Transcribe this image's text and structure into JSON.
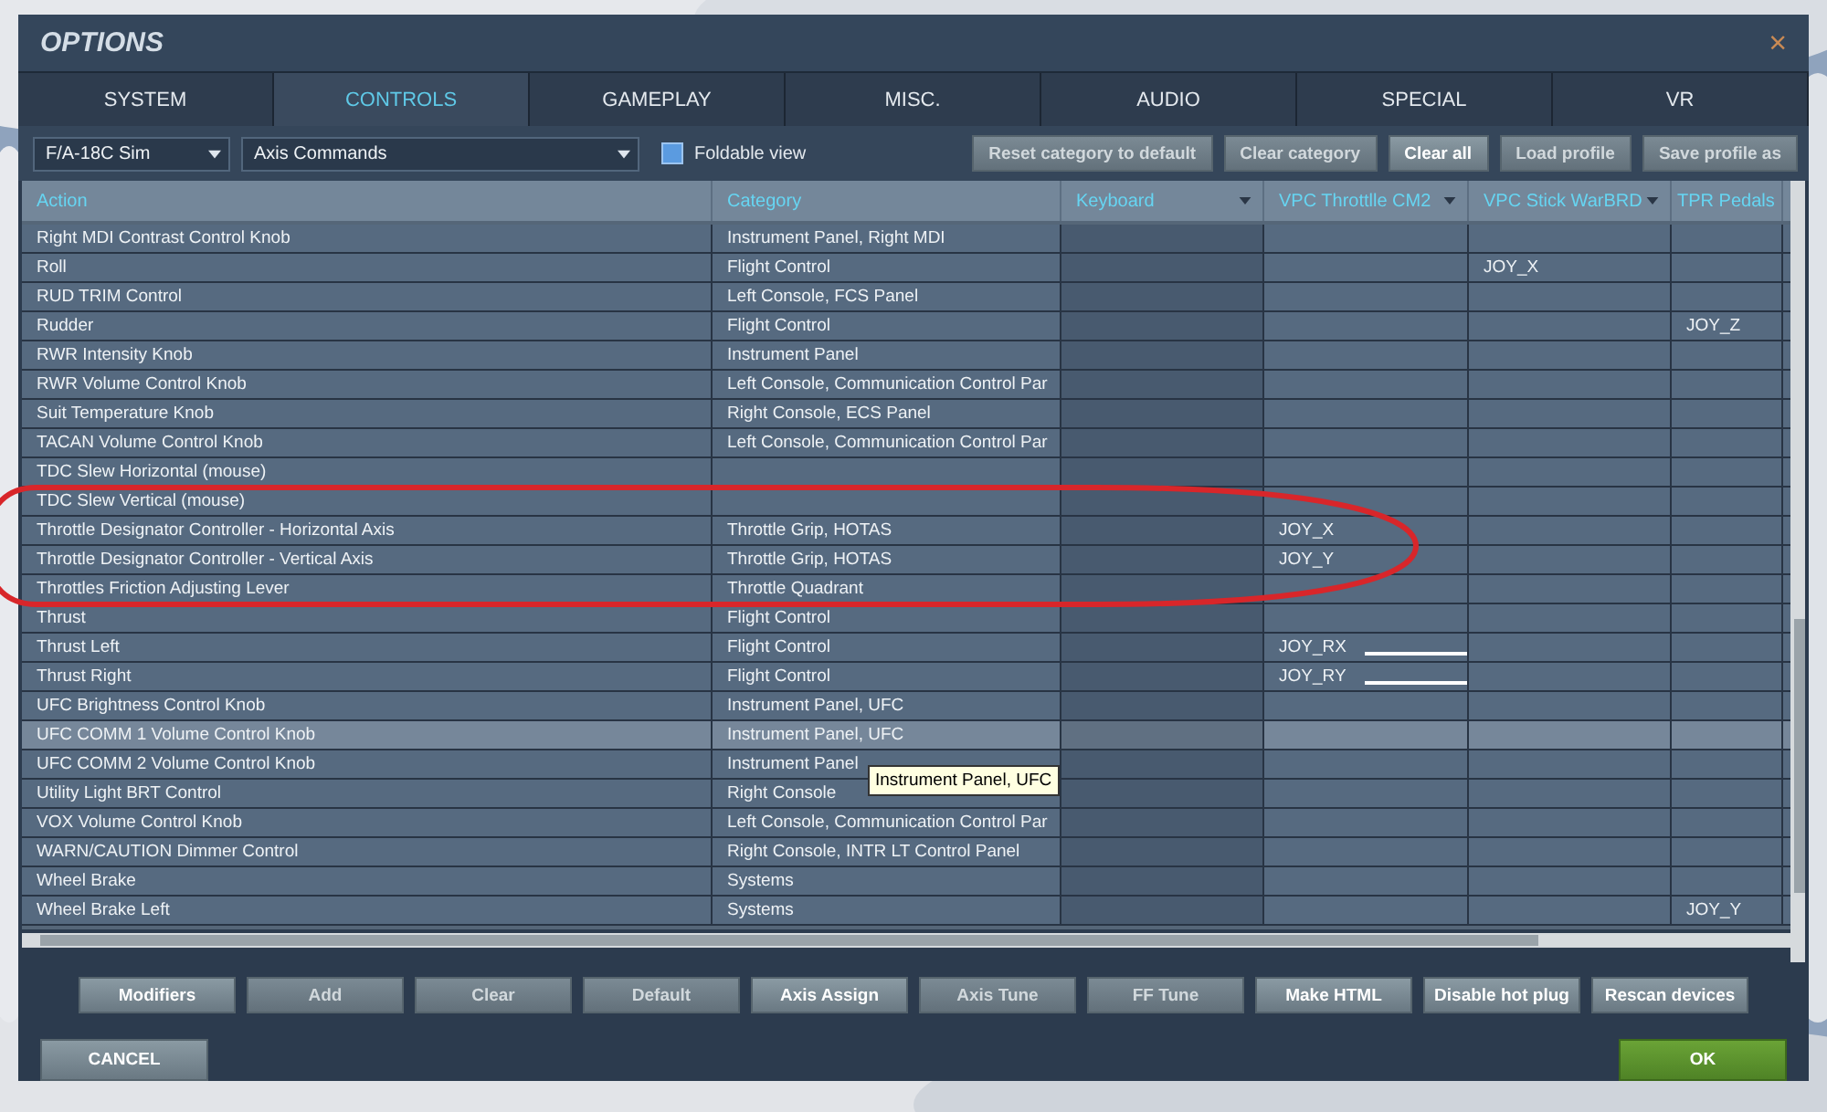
{
  "window": {
    "title": "OPTIONS",
    "close": "×"
  },
  "tabs": [
    {
      "label": "SYSTEM",
      "selected": false
    },
    {
      "label": "CONTROLS",
      "selected": true
    },
    {
      "label": "GAMEPLAY",
      "selected": false
    },
    {
      "label": "MISC.",
      "selected": false
    },
    {
      "label": "AUDIO",
      "selected": false
    },
    {
      "label": "SPECIAL",
      "selected": false
    },
    {
      "label": "VR",
      "selected": false
    }
  ],
  "toolbar": {
    "aircraft": "F/A-18C Sim",
    "category": "Axis Commands",
    "foldable_view": {
      "label": "Foldable view",
      "checked": true
    },
    "buttons": [
      {
        "label": "Reset category to default",
        "disabled": true
      },
      {
        "label": "Clear category",
        "disabled": true
      },
      {
        "label": "Clear all",
        "disabled": false
      },
      {
        "label": "Load profile",
        "disabled": true
      },
      {
        "label": "Save profile as",
        "disabled": true
      }
    ]
  },
  "table": {
    "columns": [
      {
        "label": "Action",
        "has_menu": false
      },
      {
        "label": "Category",
        "has_menu": false
      },
      {
        "label": "Keyboard",
        "has_menu": true
      },
      {
        "label": "VPC Throttlle CM2",
        "has_menu": true
      },
      {
        "label": "VPC Stick WarBRD",
        "has_menu": true
      },
      {
        "label": "TPR Pedals",
        "has_menu": false
      }
    ],
    "rows": [
      {
        "action": "Right MDI Contrast Control Knob",
        "category": "Instrument Panel, Right MDI",
        "selected": false,
        "throttle_line": false
      },
      {
        "action": "Roll",
        "category": "Flight Control",
        "stick": "JOY_X",
        "selected": false,
        "throttle_line": false
      },
      {
        "action": "RUD TRIM Control",
        "category": "Left Console, FCS Panel",
        "selected": false,
        "throttle_line": false
      },
      {
        "action": "Rudder",
        "category": "Flight Control",
        "pedals": "JOY_Z",
        "selected": false,
        "throttle_line": false
      },
      {
        "action": "RWR Intensity Knob",
        "category": "Instrument Panel",
        "selected": false,
        "throttle_line": false
      },
      {
        "action": "RWR Volume Control Knob",
        "category": "Left Console, Communication Control Par",
        "selected": false,
        "throttle_line": false
      },
      {
        "action": "Suit Temperature Knob",
        "category": "Right Console, ECS Panel",
        "selected": false,
        "throttle_line": false
      },
      {
        "action": "TACAN Volume Control Knob",
        "category": "Left Console, Communication Control Par",
        "selected": false,
        "throttle_line": false
      },
      {
        "action": "TDC Slew Horizontal (mouse)",
        "selected": false,
        "throttle_line": false
      },
      {
        "action": "TDC Slew Vertical (mouse)",
        "selected": false,
        "throttle_line": false
      },
      {
        "action": "Throttle Designator Controller - Horizontal Axis",
        "category": "Throttle Grip, HOTAS",
        "throttle": "JOY_X",
        "selected": false,
        "throttle_line": false
      },
      {
        "action": "Throttle Designator Controller - Vertical Axis",
        "category": "Throttle Grip, HOTAS",
        "throttle": "JOY_Y",
        "selected": false,
        "throttle_line": false
      },
      {
        "action": "Throttles Friction Adjusting Lever",
        "category": "Throttle Quadrant",
        "selected": false,
        "throttle_line": false
      },
      {
        "action": "Thrust",
        "category": "Flight Control",
        "selected": false,
        "throttle_line": false
      },
      {
        "action": "Thrust Left",
        "category": "Flight Control",
        "throttle": "JOY_RX",
        "selected": false,
        "throttle_line": true
      },
      {
        "action": "Thrust Right",
        "category": "Flight Control",
        "throttle": "JOY_RY",
        "selected": false,
        "throttle_line": true
      },
      {
        "action": "UFC Brightness Control Knob",
        "category": "Instrument Panel, UFC",
        "selected": false,
        "throttle_line": false
      },
      {
        "action": "UFC COMM 1 Volume Control Knob",
        "category": "Instrument Panel, UFC",
        "selected": true,
        "throttle_line": false
      },
      {
        "action": "UFC COMM 2 Volume Control Knob",
        "category": "Instrument Panel",
        "selected": false,
        "throttle_line": false
      },
      {
        "action": "Utility Light BRT Control",
        "category": "Right Console",
        "selected": false,
        "throttle_line": false
      },
      {
        "action": "VOX Volume Control Knob",
        "category": "Left Console, Communication Control Par",
        "selected": false,
        "throttle_line": false
      },
      {
        "action": "WARN/CAUTION Dimmer Control",
        "category": "Right Console, INTR LT Control Panel",
        "selected": false,
        "throttle_line": false
      },
      {
        "action": "Wheel Brake",
        "category": "Systems",
        "selected": false,
        "throttle_line": false
      },
      {
        "action": "Wheel Brake Left",
        "category": "Systems",
        "pedals": "JOY_Y",
        "selected": false,
        "throttle_line": false
      }
    ],
    "tooltip": "Instrument Panel, UFC"
  },
  "bottom_buttons": [
    {
      "label": "Modifiers",
      "disabled": false
    },
    {
      "label": "Add",
      "disabled": true
    },
    {
      "label": "Clear",
      "disabled": true
    },
    {
      "label": "Default",
      "disabled": true
    },
    {
      "label": "Axis Assign",
      "disabled": false
    },
    {
      "label": "Axis Tune",
      "disabled": true
    },
    {
      "label": "FF Tune",
      "disabled": true
    },
    {
      "label": "Make HTML",
      "disabled": false
    },
    {
      "label": "Disable hot plug",
      "disabled": false
    },
    {
      "label": "Rescan devices",
      "disabled": false
    }
  ],
  "footer": {
    "cancel": "CANCEL",
    "ok": "OK"
  }
}
